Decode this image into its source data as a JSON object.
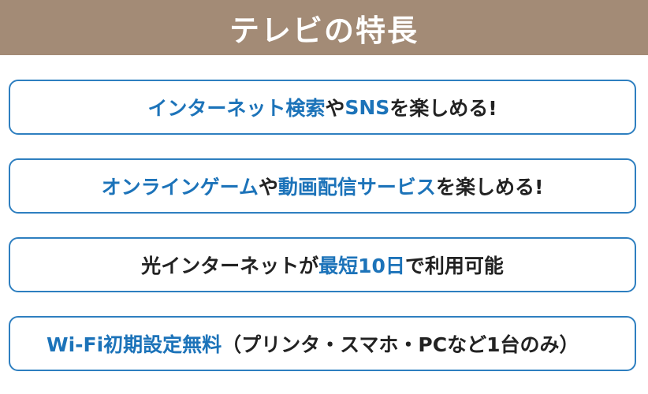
{
  "header": {
    "title": "テレビの特長"
  },
  "features": [
    {
      "parts": [
        {
          "text": "インターネット検索",
          "highlight": true
        },
        {
          "text": "や",
          "highlight": false
        },
        {
          "text": "SNS",
          "highlight": true
        },
        {
          "text": "を楽しめる!",
          "highlight": false
        }
      ]
    },
    {
      "parts": [
        {
          "text": "オンラインゲーム",
          "highlight": true
        },
        {
          "text": "や",
          "highlight": false
        },
        {
          "text": "動画配信サービス",
          "highlight": true
        },
        {
          "text": "を楽しめる!",
          "highlight": false
        }
      ]
    },
    {
      "parts": [
        {
          "text": "光インターネットが",
          "highlight": false
        },
        {
          "text": "最短10日",
          "highlight": true
        },
        {
          "text": "で利用可能",
          "highlight": false
        }
      ]
    },
    {
      "parts": [
        {
          "text": "Wi-Fi初期設定無料",
          "highlight": true
        },
        {
          "text": "（プリンタ・スマホ・PCなど1台のみ）",
          "highlight": false
        }
      ]
    }
  ],
  "colors": {
    "header_bg": "#a38b76",
    "accent_blue": "#1c73b9",
    "border_blue": "#2e7fc0",
    "text_dark": "#222222"
  }
}
